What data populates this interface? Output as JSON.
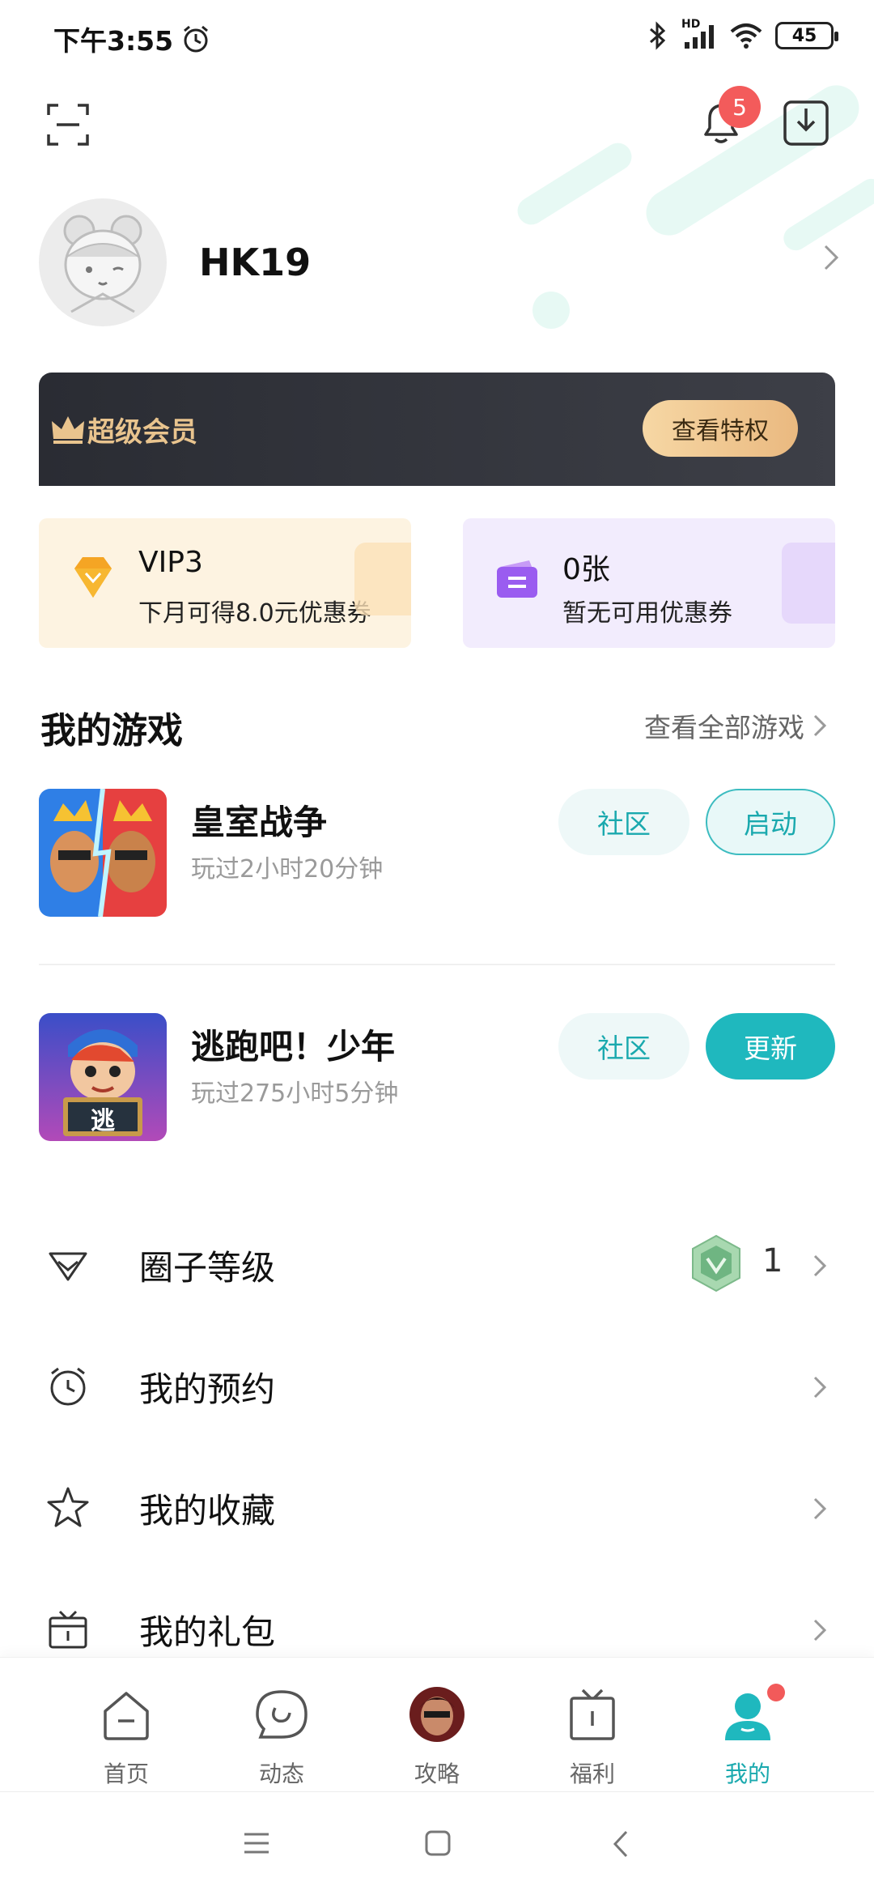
{
  "status_bar": {
    "time": "下午3:55",
    "network_label": "HD",
    "battery": "45"
  },
  "header": {
    "notification_count": "5"
  },
  "profile": {
    "username": "HK19"
  },
  "vip": {
    "title": "超级会员",
    "button": "查看特权"
  },
  "promos": {
    "vip": {
      "title": "VIP3",
      "subtitle": "下月可得8.0元优惠券"
    },
    "coupon": {
      "title": "0张",
      "subtitle": "暂无可用优惠券"
    }
  },
  "my_games": {
    "title": "我的游戏",
    "view_all": "查看全部游戏",
    "games": [
      {
        "name": "皇室战争",
        "played": "玩过2小时20分钟",
        "community": "社区",
        "action": "启动"
      },
      {
        "name": "逃跑吧！少年",
        "played": "玩过275小时5分钟",
        "community": "社区",
        "action": "更新",
        "icon_text": "逃"
      }
    ]
  },
  "menu": {
    "items": [
      {
        "label": "圈子等级",
        "value": "1"
      },
      {
        "label": "我的预约"
      },
      {
        "label": "我的收藏"
      },
      {
        "label": "我的礼包"
      }
    ]
  },
  "bottom_nav": {
    "items": [
      {
        "label": "首页"
      },
      {
        "label": "动态"
      },
      {
        "label": "攻略"
      },
      {
        "label": "福利"
      },
      {
        "label": "我的"
      }
    ]
  },
  "colors": {
    "accent": "#1fb8be",
    "badge": "#f35b5b",
    "vip_gold": "#e9c48e"
  }
}
